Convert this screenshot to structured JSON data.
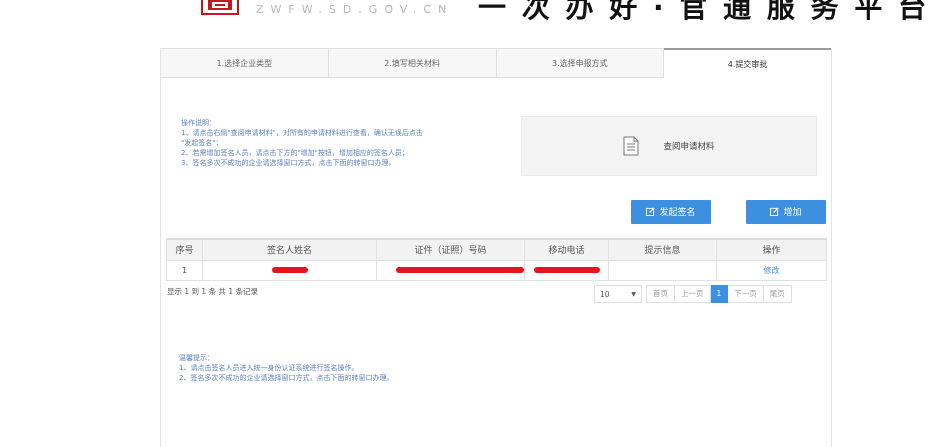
{
  "header": {
    "site_url": "ZWFW.SD.GOV.CN",
    "slogan": "一 次 办 好  ·  官 通 服 务 平 台"
  },
  "steps": [
    {
      "label": "1.选择企业类型",
      "active": false
    },
    {
      "label": "2.填写相关材料",
      "active": false
    },
    {
      "label": "3.选择申报方式",
      "active": false
    },
    {
      "label": "4.提交审批",
      "active": true
    }
  ],
  "instructions": {
    "title": "操作说明：",
    "lines": [
      "1、请点击右侧\"查阅申请材料\"，对所有的申请材料进行查看，确认无误后点击",
      "\"发起签名\"；",
      "2、若需增加签名人员，请点击下方的\"增加\"按钮，增加相应的签名人员；",
      "3、签名多次不成功的企业请选择窗口方式，点击下面的转窗口办理。"
    ]
  },
  "view_materials": {
    "icon": "document-icon",
    "label": "查阅申请材料"
  },
  "actions": {
    "sign_label": "发起签名",
    "add_label": "增加"
  },
  "table": {
    "headers": [
      "序号",
      "签名人姓名",
      "证件（证照）号码",
      "移动电话",
      "提示信息",
      "操作"
    ],
    "rows": [
      {
        "index": "1",
        "name": "[redacted]",
        "id_number": "[redacted]",
        "phone": "[redacted]",
        "message": "",
        "action": "修改"
      }
    ]
  },
  "record_info": "显示 1 到 1 条 共 1 条记录",
  "pagination": {
    "page_size": "10",
    "first": "首页",
    "prev": "上一页",
    "current": "1",
    "next": "下一页",
    "last": "尾页"
  },
  "tips": {
    "title": "温馨提示：",
    "lines": [
      "1、请点击签名人员进入统一身份认证系统进行签名操作。",
      "2、签名多次不成功的企业请选择窗口方式，点击下面的转窗口办理。"
    ]
  },
  "colors": {
    "primary": "#3d8fe0",
    "instruction_text": "#5b7fc4",
    "redaction": "#e8141c"
  }
}
